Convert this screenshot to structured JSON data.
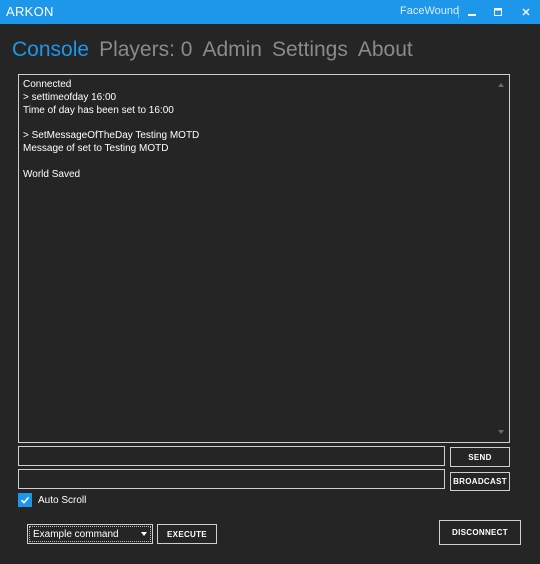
{
  "app": {
    "title": "ARKON",
    "user": "FaceWound"
  },
  "tabs": [
    {
      "label": "Console",
      "active": true
    },
    {
      "label": "Players: 0",
      "active": false
    },
    {
      "label": "Admin",
      "active": false
    },
    {
      "label": "Settings",
      "active": false
    },
    {
      "label": "About",
      "active": false
    }
  ],
  "console": {
    "lines": [
      "Connected",
      "> settimeofday 16:00",
      "Time of day has been set to 16:00",
      "",
      "> SetMessageOfTheDay Testing MOTD",
      "Message of set to Testing MOTD",
      "",
      "World Saved"
    ]
  },
  "send": {
    "input_value": "",
    "button_label": "SEND"
  },
  "broadcast": {
    "input_value": "",
    "button_label": "BROADCAST"
  },
  "autoscroll": {
    "label": "Auto Scroll",
    "checked": true
  },
  "command": {
    "selected": "Example command",
    "execute_label": "EXECUTE"
  },
  "disconnect_label": "DISCONNECT",
  "colors": {
    "accent": "#1c97ea",
    "background": "#252526",
    "inactive_tab": "#8a8a8a",
    "border": "#cfcfcf"
  },
  "icons": {
    "minimize": "minimize-icon",
    "maximize": "maximize-icon",
    "close": "close-icon",
    "scroll_up": "scroll-up-icon",
    "scroll_down": "scroll-down-icon",
    "checkmark": "checkmark-icon",
    "dropdown": "chevron-down-icon"
  }
}
